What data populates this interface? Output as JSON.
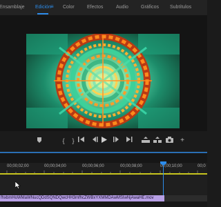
{
  "workspaces": {
    "tabs": [
      {
        "label": "Ensamblaje",
        "active": false
      },
      {
        "label": "Edición",
        "active": true
      },
      {
        "label": "Color",
        "active": false
      },
      {
        "label": "Efectos",
        "active": false
      },
      {
        "label": "Audio",
        "active": false
      },
      {
        "label": "Gráficos",
        "active": false
      },
      {
        "label": "Subtítulos",
        "active": false
      }
    ],
    "menu_icon": "hamburger-menu-icon",
    "accent_color": "#2d8ceb"
  },
  "monitor": {
    "preview": "tunnel-spiral-video-frame"
  },
  "transport": {
    "controls": [
      "marker-icon",
      "mark-in-icon",
      "mark-out-icon",
      "go-to-in-icon",
      "step-back-icon",
      "play-icon",
      "step-forward-icon",
      "go-to-out-icon",
      "lift-icon",
      "extract-icon",
      "export-frame-icon",
      "add-button-icon"
    ]
  },
  "timeline": {
    "timecodes": [
      "00;00;02;00",
      "00;00;04;00",
      "00;00;06;00",
      "00;00;08;00",
      "00;00;10;00",
      "00;0"
    ],
    "clip_name": "fhxbmHoWMaWNucQDdSQNDQwcHH3mfhcZWBxYXMMDAwMSIwNjAwaHE.mov",
    "clip_color": "#b8a0e6",
    "work_area_color": "#c8c51e"
  }
}
